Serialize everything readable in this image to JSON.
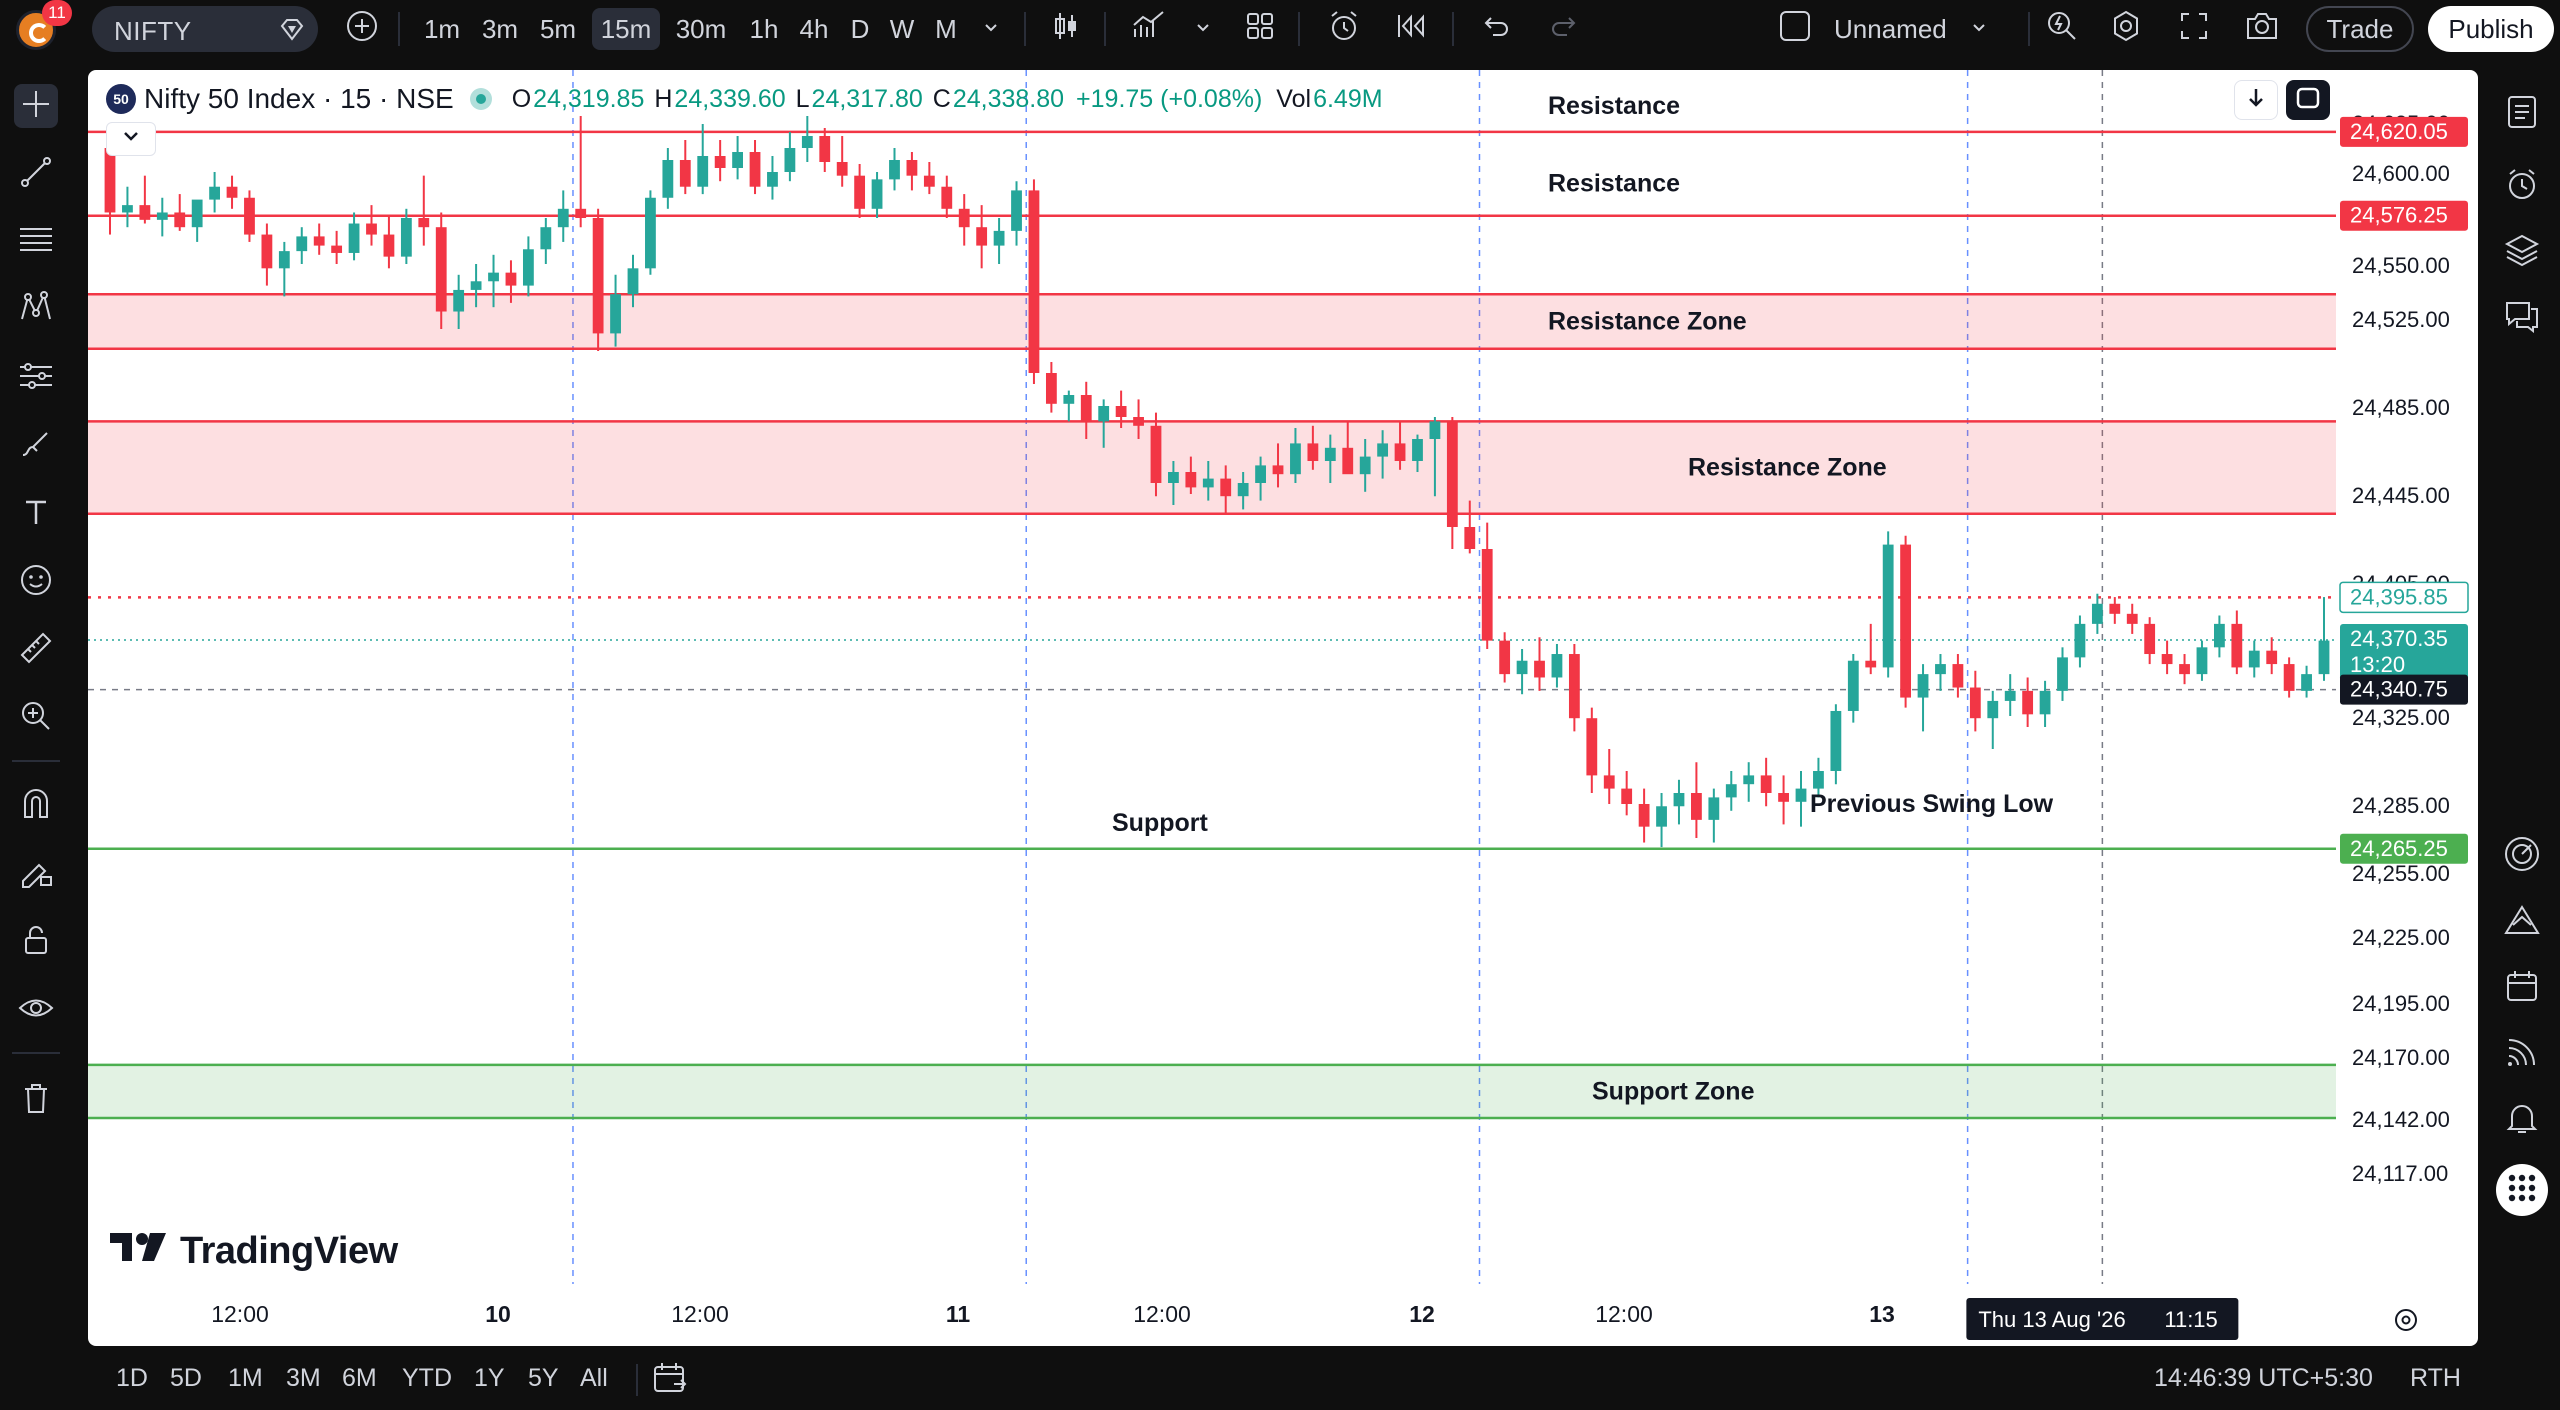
{
  "topbar": {
    "notifications": "11",
    "symbol": "NIFTY",
    "timeframes": [
      "1m",
      "3m",
      "5m",
      "15m",
      "30m",
      "1h",
      "4h",
      "D",
      "W",
      "M"
    ],
    "active_timeframe": "15m",
    "layout_name": "Unnamed",
    "trade_label": "Trade",
    "publish_label": "Publish"
  },
  "legend": {
    "badge": "50",
    "title": "Nifty 50 Index · 15 · NSE",
    "o_label": "O",
    "o_value": "24,319.85",
    "h_label": "H",
    "h_value": "24,339.60",
    "l_label": "L",
    "l_value": "24,317.80",
    "c_label": "C",
    "c_value": "24,338.80",
    "change": "+19.75 (+0.08%)",
    "vol_label": "Vol",
    "vol_value": "6.49M"
  },
  "watermark": "TradingView",
  "chart_data": {
    "type": "candlestick",
    "symbol": "Nifty 50 Index",
    "interval": "15",
    "exchange": "NSE",
    "y_ticks": [
      "24,625.00",
      "24,600.00",
      "24,550.00",
      "24,525.00",
      "24,485.00",
      "24,445.00",
      "24,405.00",
      "24,325.00",
      "24,285.00",
      "24,255.00",
      "24,225.00",
      "24,195.00",
      "24,170.00",
      "24,142.00",
      "24,117.00"
    ],
    "y_tick_values": [
      24625,
      24600,
      24550,
      24525,
      24485,
      24445,
      24405,
      24325,
      24285,
      24255,
      24225,
      24195,
      24170,
      24142,
      24117
    ],
    "x_ticks": [
      "12:00",
      "10",
      "12:00",
      "11",
      "12:00",
      "12",
      "12:00",
      "13"
    ],
    "price_labels": [
      {
        "text": "24,620.05",
        "value": 24620.05,
        "kind": "red"
      },
      {
        "text": "24,576.25",
        "value": 24576.25,
        "kind": "red"
      },
      {
        "text": "24,395.85",
        "value": 24395.85,
        "kind": "outline"
      },
      {
        "text": "24,370.35",
        "sub": "13:20",
        "value": 24370.35,
        "kind": "green-last"
      },
      {
        "text": "24,340.75",
        "value": 24340.75,
        "kind": "dark"
      },
      {
        "text": "24,265.25",
        "value": 24265.25,
        "kind": "green"
      }
    ],
    "levels": [
      {
        "label": "Resistance",
        "type": "line",
        "value": 24620.05,
        "color": "#f23645"
      },
      {
        "label": "Resistance",
        "type": "line",
        "value": 24576.25,
        "color": "#f23645"
      },
      {
        "label": "Resistance Zone",
        "type": "zone",
        "from": 24511,
        "to": 24536,
        "color": "#f23645"
      },
      {
        "label": "Resistance Zone",
        "type": "zone",
        "from": 24436,
        "to": 24478,
        "color": "#f23645"
      },
      {
        "label": "Previous Swing Low",
        "type": "text",
        "value": 24285
      },
      {
        "label": "Support",
        "type": "line",
        "value": 24265.25,
        "color": "#4caf50"
      },
      {
        "label": "Support Zone",
        "type": "zone",
        "from": 24142,
        "to": 24166,
        "color": "#4caf50"
      }
    ],
    "candles": [
      [
        24612,
        24622,
        24566,
        24578
      ],
      [
        24578,
        24592,
        24570,
        24582
      ],
      [
        24582,
        24598,
        24572,
        24574
      ],
      [
        24574,
        24586,
        24565,
        24578
      ],
      [
        24578,
        24588,
        24568,
        24570
      ],
      [
        24570,
        24580,
        24562,
        24585
      ],
      [
        24585,
        24600,
        24578,
        24592
      ],
      [
        24592,
        24598,
        24580,
        24586
      ],
      [
        24586,
        24590,
        24562,
        24566
      ],
      [
        24566,
        24572,
        24540,
        24548
      ],
      [
        24548,
        24562,
        24535,
        24557
      ],
      [
        24557,
        24570,
        24550,
        24565
      ],
      [
        24565,
        24572,
        24555,
        24560
      ],
      [
        24560,
        24568,
        24550,
        24556
      ],
      [
        24556,
        24578,
        24552,
        24572
      ],
      [
        24572,
        24582,
        24560,
        24566
      ],
      [
        24566,
        24576,
        24548,
        24554
      ],
      [
        24554,
        24580,
        24550,
        24575
      ],
      [
        24575,
        24598,
        24560,
        24570
      ],
      [
        24570,
        24578,
        24520,
        24528
      ],
      [
        24528,
        24545,
        24520,
        24538
      ],
      [
        24538,
        24550,
        24530,
        24542
      ],
      [
        24542,
        24555,
        24530,
        24546
      ],
      [
        24546,
        24552,
        24532,
        24540
      ],
      [
        24540,
        24565,
        24535,
        24558
      ],
      [
        24558,
        24575,
        24550,
        24570
      ],
      [
        24570,
        24590,
        24562,
        24580
      ],
      [
        24580,
        24628,
        24570,
        24575
      ],
      [
        24575,
        24580,
        24510,
        24518
      ],
      [
        24518,
        24545,
        24512,
        24536
      ],
      [
        24536,
        24555,
        24530,
        24548
      ],
      [
        24548,
        24590,
        24545,
        24586
      ],
      [
        24586,
        24612,
        24580,
        24606
      ],
      [
        24606,
        24616,
        24588,
        24592
      ],
      [
        24592,
        24624,
        24588,
        24608
      ],
      [
        24608,
        24616,
        24595,
        24602
      ],
      [
        24602,
        24618,
        24596,
        24610
      ],
      [
        24610,
        24616,
        24588,
        24592
      ],
      [
        24592,
        24608,
        24585,
        24600
      ],
      [
        24600,
        24620,
        24595,
        24612
      ],
      [
        24612,
        24628,
        24605,
        24618
      ],
      [
        24618,
        24622,
        24600,
        24605
      ],
      [
        24605,
        24618,
        24592,
        24598
      ],
      [
        24598,
        24604,
        24575,
        24580
      ],
      [
        24580,
        24600,
        24575,
        24596
      ],
      [
        24596,
        24612,
        24590,
        24606
      ],
      [
        24606,
        24610,
        24590,
        24598
      ],
      [
        24598,
        24605,
        24588,
        24592
      ],
      [
        24592,
        24598,
        24575,
        24580
      ],
      [
        24580,
        24588,
        24560,
        24570
      ],
      [
        24570,
        24582,
        24548,
        24560
      ],
      [
        24560,
        24575,
        24550,
        24568
      ],
      [
        24568,
        24595,
        24560,
        24590
      ],
      [
        24590,
        24596,
        24495,
        24500
      ],
      [
        24500,
        24505,
        24482,
        24486
      ],
      [
        24486,
        24492,
        24478,
        24490
      ],
      [
        24490,
        24496,
        24470,
        24478
      ],
      [
        24478,
        24488,
        24466,
        24485
      ],
      [
        24485,
        24492,
        24475,
        24480
      ],
      [
        24480,
        24488,
        24470,
        24476
      ],
      [
        24476,
        24482,
        24444,
        24450
      ],
      [
        24450,
        24460,
        24440,
        24455
      ],
      [
        24455,
        24462,
        24445,
        24448
      ],
      [
        24448,
        24460,
        24442,
        24452
      ],
      [
        24452,
        24458,
        24436,
        24444
      ],
      [
        24444,
        24455,
        24438,
        24450
      ],
      [
        24450,
        24462,
        24442,
        24458
      ],
      [
        24458,
        24468,
        24448,
        24454
      ],
      [
        24454,
        24475,
        24450,
        24468
      ],
      [
        24468,
        24476,
        24456,
        24460
      ],
      [
        24460,
        24472,
        24450,
        24466
      ],
      [
        24466,
        24478,
        24455,
        24454
      ],
      [
        24454,
        24470,
        24446,
        24462
      ],
      [
        24462,
        24474,
        24452,
        24468
      ],
      [
        24468,
        24478,
        24456,
        24460
      ],
      [
        24460,
        24472,
        24455,
        24470
      ],
      [
        24470,
        24480,
        24444,
        24478
      ],
      [
        24478,
        24480,
        24420,
        24430
      ],
      [
        24430,
        24442,
        24418,
        24420
      ],
      [
        24420,
        24432,
        24365,
        24370
      ],
      [
        24370,
        24375,
        24345,
        24350
      ],
      [
        24350,
        24365,
        24338,
        24358
      ],
      [
        24358,
        24372,
        24340,
        24348
      ],
      [
        24348,
        24368,
        24342,
        24362
      ],
      [
        24362,
        24368,
        24318,
        24324
      ],
      [
        24324,
        24330,
        24290,
        24298
      ],
      [
        24298,
        24310,
        24285,
        24292
      ],
      [
        24292,
        24300,
        24280,
        24285
      ],
      [
        24285,
        24292,
        24268,
        24275
      ],
      [
        24275,
        24290,
        24266,
        24284
      ],
      [
        24284,
        24296,
        24276,
        24290
      ],
      [
        24290,
        24304,
        24270,
        24278
      ],
      [
        24278,
        24292,
        24268,
        24288
      ],
      [
        24288,
        24300,
        24282,
        24294
      ],
      [
        24294,
        24304,
        24286,
        24298
      ],
      [
        24298,
        24306,
        24284,
        24290
      ],
      [
        24290,
        24298,
        24276,
        24286
      ],
      [
        24286,
        24300,
        24275,
        24292
      ],
      [
        24292,
        24306,
        24288,
        24300
      ],
      [
        24300,
        24332,
        24294,
        24328
      ],
      [
        24328,
        24362,
        24322,
        24358
      ],
      [
        24358,
        24380,
        24350,
        24354
      ],
      [
        24354,
        24428,
        24348,
        24422
      ],
      [
        24422,
        24426,
        24330,
        24336
      ],
      [
        24336,
        24356,
        24318,
        24350
      ],
      [
        24350,
        24362,
        24340,
        24356
      ],
      [
        24356,
        24362,
        24336,
        24342
      ],
      [
        24342,
        24352,
        24318,
        24324
      ],
      [
        24324,
        24340,
        24310,
        24334
      ],
      [
        24334,
        24350,
        24325,
        24340
      ],
      [
        24340,
        24348,
        24320,
        24326
      ],
      [
        24326,
        24346,
        24320,
        24340
      ],
      [
        24340,
        24366,
        24334,
        24360
      ],
      [
        24360,
        24385,
        24354,
        24380
      ],
      [
        24380,
        24398,
        24374,
        24392
      ],
      [
        24392,
        24396,
        24380,
        24386
      ],
      [
        24386,
        24392,
        24374,
        24380
      ],
      [
        24380,
        24384,
        24356,
        24362
      ],
      [
        24362,
        24370,
        24350,
        24356
      ],
      [
        24356,
        24362,
        24344,
        24350
      ],
      [
        24350,
        24370,
        24346,
        24366
      ],
      [
        24366,
        24385,
        24360,
        24380
      ],
      [
        24380,
        24388,
        24350,
        24354
      ],
      [
        24354,
        24370,
        24348,
        24364
      ],
      [
        24364,
        24372,
        24350,
        24356
      ],
      [
        24356,
        24360,
        24336,
        24340
      ],
      [
        24340,
        24355,
        24336,
        24350
      ],
      [
        24350,
        24396,
        24346,
        24370
      ]
    ]
  },
  "chart_controls": {
    "bottom_time_label": "Thu 13 Aug '26",
    "bottom_time_value": "11:15"
  },
  "bottombar": {
    "ranges": [
      "1D",
      "5D",
      "1M",
      "3M",
      "6M",
      "YTD",
      "1Y",
      "5Y",
      "All"
    ],
    "clock": "14:46:39 UTC+5:30",
    "session": "RTH"
  },
  "colors": {
    "up": "#26a69a",
    "down": "#f23645",
    "resistance": "#f23645",
    "support": "#4caf50"
  },
  "icons": {
    "left": [
      "crosshair-icon",
      "trend-line-icon",
      "fib-icon",
      "pattern-icon",
      "forecast-icon",
      "brush-icon",
      "text-icon",
      "emoji-icon",
      "ruler-icon",
      "zoom-icon",
      "magnet-icon",
      "lock-drawing-icon",
      "lock-icon",
      "eye-icon",
      "trash-icon"
    ],
    "right": [
      "watchlist-icon",
      "alert-clock-icon",
      "layers-icon",
      "chat-icon",
      "target-icon",
      "signal-icon",
      "calendar-icon",
      "broadcast-icon",
      "bell-icon",
      "apps-icon"
    ]
  }
}
